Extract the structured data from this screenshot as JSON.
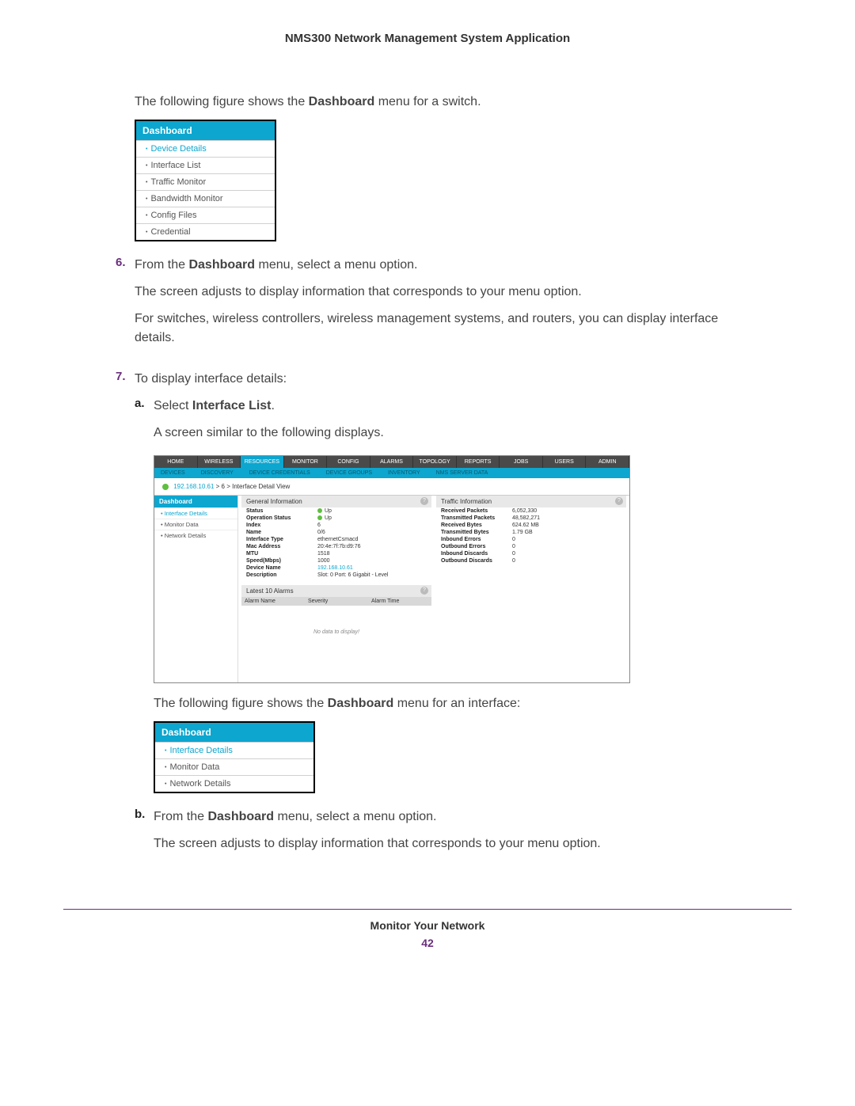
{
  "doc_title": "NMS300 Network Management System Application",
  "intro_text": {
    "pre": "The following figure shows the ",
    "bold": "Dashboard",
    "post": " menu for a switch."
  },
  "menu1": {
    "header": "Dashboard",
    "items": [
      "Device Details",
      "Interface List",
      "Traffic Monitor",
      "Bandwidth Monitor",
      "Config Files",
      "Credential"
    ],
    "active_index": 0
  },
  "step6": {
    "num": "6.",
    "line1": {
      "pre": "From the ",
      "bold": "Dashboard",
      "post": " menu, select a menu option."
    },
    "line2": "The screen adjusts to display information that corresponds to your menu option.",
    "line3": "For switches, wireless controllers, wireless management systems, and routers, you can display interface details."
  },
  "step7": {
    "num": "7.",
    "line1": "To display interface details:",
    "a": {
      "letter": "a.",
      "pre": "Select ",
      "bold": "Interface List",
      "post": "."
    },
    "a_line2": "A screen similar to the following displays."
  },
  "app": {
    "tabs": [
      "HOME",
      "WIRELESS",
      "RESOURCES",
      "MONITOR",
      "CONFIG",
      "ALARMS",
      "TOPOLOGY",
      "REPORTS",
      "JOBS",
      "USERS",
      "ADMIN"
    ],
    "active_tab_index": 2,
    "subtabs": [
      "DEVICES",
      "DISCOVERY",
      "DEVICE CREDENTIALS",
      "DEVICE GROUPS",
      "INVENTORY",
      "NMS SERVER DATA"
    ],
    "breadcrumb": {
      "ip": "192.168.10.61",
      "rest": " > 6 > Interface Detail View"
    },
    "side": {
      "header": "Dashboard",
      "items": [
        "Interface Details",
        "Monitor Data",
        "Network Details"
      ],
      "active_index": 0
    },
    "geninfo": {
      "title": "General Information",
      "rows": [
        {
          "k": "Status",
          "v": "Up",
          "dot": true
        },
        {
          "k": "Operation Status",
          "v": "Up",
          "dot": true
        },
        {
          "k": "Index",
          "v": "6"
        },
        {
          "k": "Name",
          "v": "0/6"
        },
        {
          "k": "Interface Type",
          "v": "ethernetCsmacd"
        },
        {
          "k": "Mac Address",
          "v": "20:4e:7f:7b:d9:76"
        },
        {
          "k": "MTU",
          "v": "1518"
        },
        {
          "k": "Speed(Mbps)",
          "v": "1000"
        },
        {
          "k": "Device Name",
          "v": "192.168.10.61",
          "link": true
        },
        {
          "k": "Description",
          "v": "Slot: 0 Port: 6 Gigabit - Level"
        }
      ]
    },
    "traffic": {
      "title": "Traffic Information",
      "rows": [
        {
          "k": "Received Packets",
          "v": "6,052,330"
        },
        {
          "k": "Transmitted Packets",
          "v": "48,582,271"
        },
        {
          "k": "Received Bytes",
          "v": "624.62 MB"
        },
        {
          "k": "Transmitted Bytes",
          "v": "1.79 GB"
        },
        {
          "k": "Inbound Errors",
          "v": "0"
        },
        {
          "k": "Outbound Errors",
          "v": "0"
        },
        {
          "k": "Inbound Discards",
          "v": "0"
        },
        {
          "k": "Outbound Discards",
          "v": "0"
        }
      ]
    },
    "alarms": {
      "title": "Latest 10 Alarms",
      "cols": [
        "Alarm Name",
        "Severity",
        "Alarm Time"
      ],
      "empty": "No data to display!"
    }
  },
  "after_app": {
    "pre": "The following figure shows the ",
    "bold": "Dashboard",
    "post": " menu for an interface:"
  },
  "menu2": {
    "header": "Dashboard",
    "items": [
      "Interface Details",
      "Monitor Data",
      "Network Details"
    ],
    "active_index": 0
  },
  "step_b": {
    "letter": "b.",
    "line1": {
      "pre": "From the ",
      "bold": "Dashboard",
      "post": " menu, select a menu option."
    },
    "line2": "The screen adjusts to display information that corresponds to your menu option."
  },
  "footer": {
    "title": "Monitor Your Network",
    "page": "42"
  }
}
